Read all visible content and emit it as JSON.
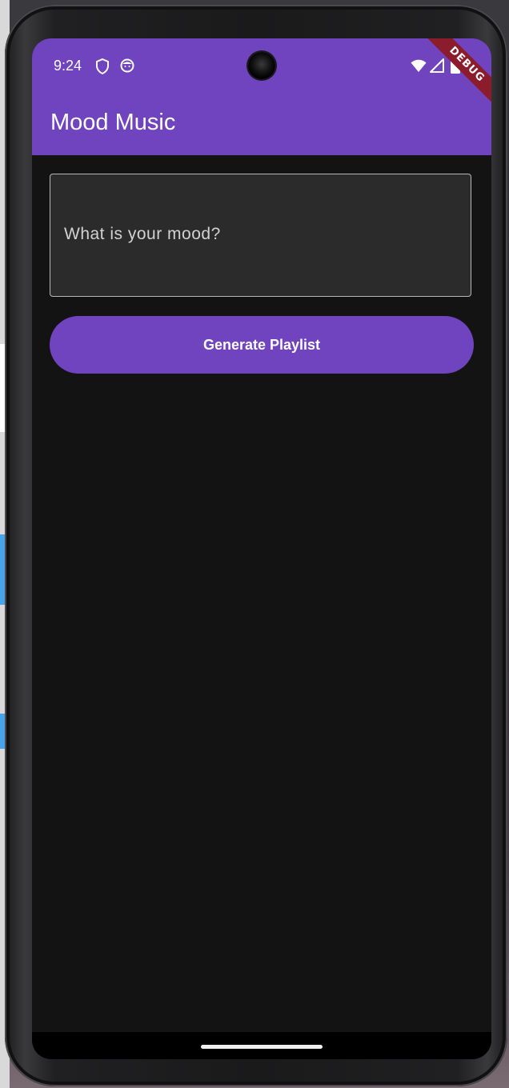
{
  "status_bar": {
    "time": "9:24",
    "icons": [
      "shield-icon",
      "face-icon",
      "camera-cutout",
      "wifi-icon",
      "signal-icon",
      "battery-icon"
    ]
  },
  "debug_banner": "DEBUG",
  "app_bar": {
    "title": "Mood Music"
  },
  "mood_input": {
    "label": "What is your mood?",
    "value": ""
  },
  "generate_button": {
    "label": "Generate Playlist"
  },
  "colors": {
    "primary": "#7043bf",
    "background": "#131313",
    "input_fill": "#2b2b2b",
    "debug_ribbon": "#8a1c2c"
  }
}
